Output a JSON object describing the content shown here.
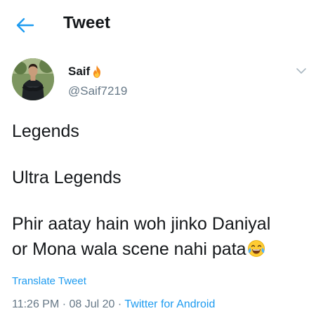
{
  "header": {
    "title": "Tweet",
    "back_icon": "arrow-left-icon"
  },
  "colors": {
    "accent": "#1d9bf0",
    "text": "#14171a",
    "muted": "#657786"
  },
  "author": {
    "display_name": "Saif",
    "name_emoji": "fire-icon",
    "handle": "@Saif7219",
    "avatar": "avatar-photo"
  },
  "tweet": {
    "line1": "Legends",
    "line2": "Ultra Legends",
    "line3": "Phir aatay hain woh jinko Daniyal",
    "line4": "or Mona wala scene nahi pata",
    "trailing_emoji": "face-with-tears-of-joy-icon"
  },
  "translate_label": "Translate Tweet",
  "meta": {
    "time": "11:26 PM",
    "separator1": " · ",
    "date": "08 Jul 20",
    "separator2": " · ",
    "source": "Twitter for Android"
  }
}
